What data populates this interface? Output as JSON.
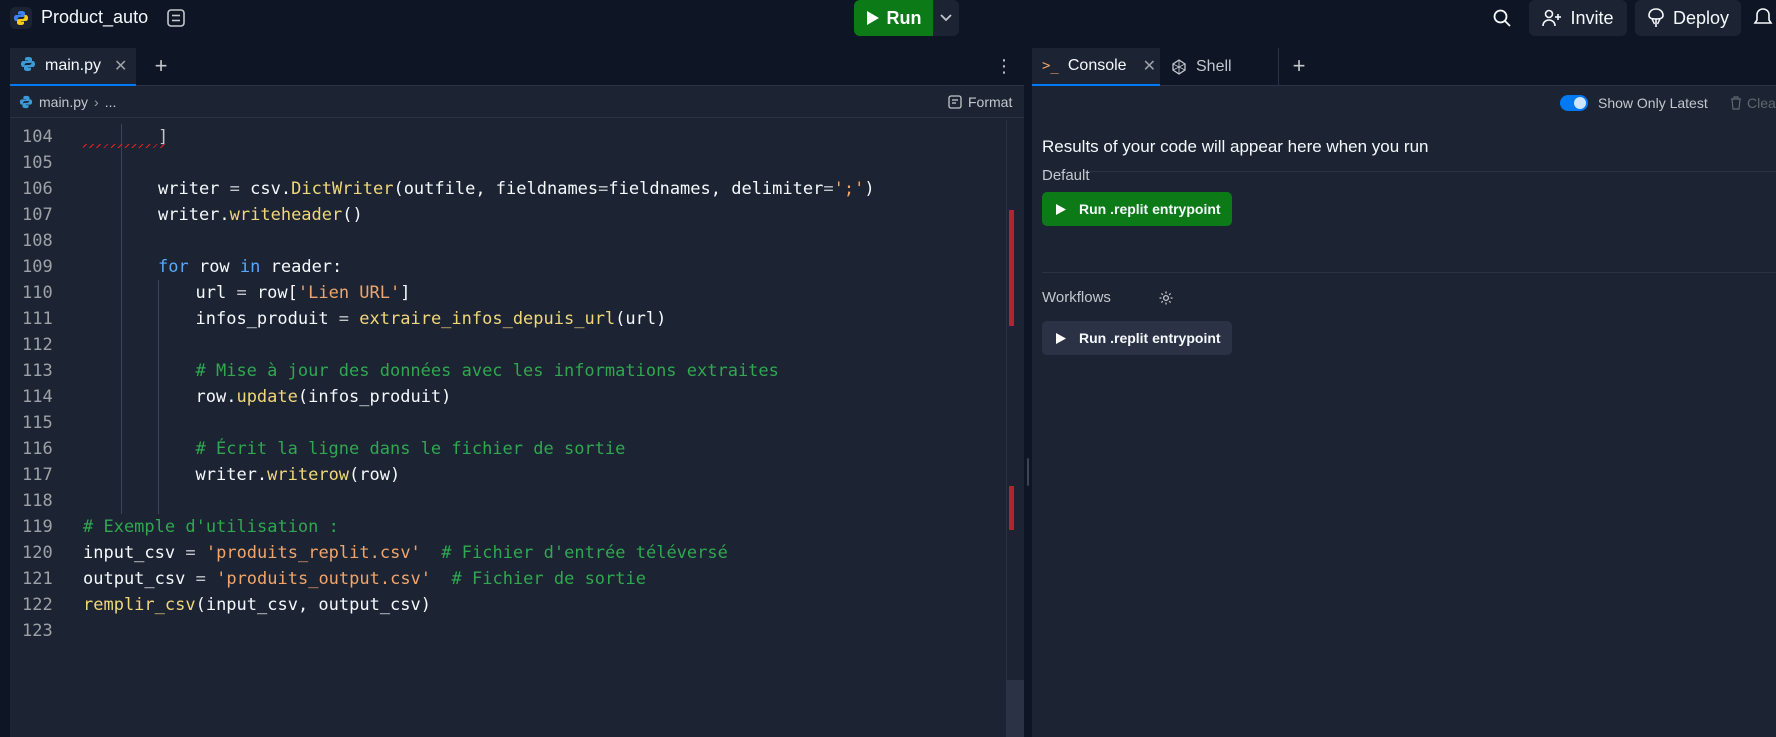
{
  "app": {
    "title": "Product_auto",
    "colors": {
      "run_green": "#0b7a17",
      "accent_blue": "#0079f2",
      "background": "#0e1525",
      "surface": "#1c2333"
    }
  },
  "topbar": {
    "run_label": "Run",
    "invite_label": "Invite",
    "deploy_label": "Deploy",
    "icons": [
      "python-logo-icon",
      "layout-icon",
      "play-icon",
      "chevron-down-icon",
      "search-icon",
      "add-user-icon",
      "deploy-icon",
      "bell-icon"
    ]
  },
  "editor": {
    "tabs": [
      {
        "label": "main.py",
        "icon": "python-icon",
        "active": true
      }
    ],
    "breadcrumb": {
      "file": "main.py",
      "sep": "›",
      "rest": "..."
    },
    "format_label": "Format",
    "lines": [
      {
        "n": "104",
        "indent": 2,
        "tokens": [
          {
            "t": "]",
            "c": "op"
          }
        ],
        "squiggle": true
      },
      {
        "n": "105",
        "indent": 0,
        "tokens": []
      },
      {
        "n": "106",
        "indent": 2,
        "tokens": [
          {
            "t": "writer ",
            "c": ""
          },
          {
            "t": "=",
            "c": "op"
          },
          {
            "t": " csv.",
            "c": ""
          },
          {
            "t": "DictWriter",
            "c": "fn"
          },
          {
            "t": "(outfile, fieldnames",
            "c": ""
          },
          {
            "t": "=",
            "c": "op"
          },
          {
            "t": "fieldnames, delimiter",
            "c": ""
          },
          {
            "t": "=",
            "c": "op"
          },
          {
            "t": "';'",
            "c": "str"
          },
          {
            "t": ")",
            "c": ""
          }
        ]
      },
      {
        "n": "107",
        "indent": 2,
        "tokens": [
          {
            "t": "writer.",
            "c": ""
          },
          {
            "t": "writeheader",
            "c": "fn"
          },
          {
            "t": "()",
            "c": ""
          }
        ]
      },
      {
        "n": "108",
        "indent": 0,
        "tokens": []
      },
      {
        "n": "109",
        "indent": 2,
        "tokens": [
          {
            "t": "for",
            "c": "kw"
          },
          {
            "t": " row ",
            "c": ""
          },
          {
            "t": "in",
            "c": "kw"
          },
          {
            "t": " reader:",
            "c": ""
          }
        ]
      },
      {
        "n": "110",
        "indent": 3,
        "tokens": [
          {
            "t": "url ",
            "c": ""
          },
          {
            "t": "=",
            "c": "op"
          },
          {
            "t": " row[",
            "c": ""
          },
          {
            "t": "'Lien URL'",
            "c": "str"
          },
          {
            "t": "]",
            "c": ""
          }
        ]
      },
      {
        "n": "111",
        "indent": 3,
        "tokens": [
          {
            "t": "infos_produit ",
            "c": ""
          },
          {
            "t": "=",
            "c": "op"
          },
          {
            "t": " ",
            "c": ""
          },
          {
            "t": "extraire_infos_depuis_url",
            "c": "fn"
          },
          {
            "t": "(url)",
            "c": ""
          }
        ]
      },
      {
        "n": "112",
        "indent": 0,
        "tokens": []
      },
      {
        "n": "113",
        "indent": 3,
        "tokens": [
          {
            "t": "# Mise à jour des données avec les informations extraites",
            "c": "com"
          }
        ]
      },
      {
        "n": "114",
        "indent": 3,
        "tokens": [
          {
            "t": "row.",
            "c": ""
          },
          {
            "t": "update",
            "c": "fn"
          },
          {
            "t": "(infos_produit)",
            "c": ""
          }
        ]
      },
      {
        "n": "115",
        "indent": 0,
        "tokens": []
      },
      {
        "n": "116",
        "indent": 3,
        "tokens": [
          {
            "t": "# Écrit la ligne dans le fichier de sortie",
            "c": "com"
          }
        ]
      },
      {
        "n": "117",
        "indent": 3,
        "tokens": [
          {
            "t": "writer.",
            "c": ""
          },
          {
            "t": "writerow",
            "c": "fn"
          },
          {
            "t": "(row)",
            "c": ""
          }
        ]
      },
      {
        "n": "118",
        "indent": 0,
        "tokens": []
      },
      {
        "n": "119",
        "indent": 0,
        "tokens": [
          {
            "t": "# Exemple d'utilisation :",
            "c": "com"
          }
        ]
      },
      {
        "n": "120",
        "indent": 0,
        "tokens": [
          {
            "t": "input_csv ",
            "c": ""
          },
          {
            "t": "=",
            "c": "op"
          },
          {
            "t": " ",
            "c": ""
          },
          {
            "t": "'produits_replit.csv'",
            "c": "str"
          },
          {
            "t": "  ",
            "c": ""
          },
          {
            "t": "# Fichier d'entrée téléversé",
            "c": "com"
          }
        ]
      },
      {
        "n": "121",
        "indent": 0,
        "tokens": [
          {
            "t": "output_csv ",
            "c": ""
          },
          {
            "t": "=",
            "c": "op"
          },
          {
            "t": " ",
            "c": ""
          },
          {
            "t": "'produits_output.csv'",
            "c": "str"
          },
          {
            "t": "  ",
            "c": ""
          },
          {
            "t": "# Fichier de sortie",
            "c": "com"
          }
        ]
      },
      {
        "n": "122",
        "indent": 0,
        "tokens": [
          {
            "t": "remplir_csv",
            "c": "fn"
          },
          {
            "t": "(input_csv, output_csv)",
            "c": ""
          }
        ]
      },
      {
        "n": "123",
        "indent": 0,
        "tokens": []
      }
    ]
  },
  "console": {
    "tabs": [
      {
        "label": "Console",
        "icon": "terminal-prompt-icon",
        "prompt": ">_",
        "active": true
      },
      {
        "label": "Shell",
        "icon": "shell-icon",
        "active": false
      }
    ],
    "show_only_latest_label": "Show Only Latest",
    "show_only_latest": true,
    "clear_label": "Clear",
    "results_message": "Results of your code will appear here when you run",
    "default_label": "Default",
    "default_run_label": "Run .replit entrypoint",
    "workflows_label": "Workflows",
    "workflow_run_label": "Run .replit entrypoint"
  }
}
